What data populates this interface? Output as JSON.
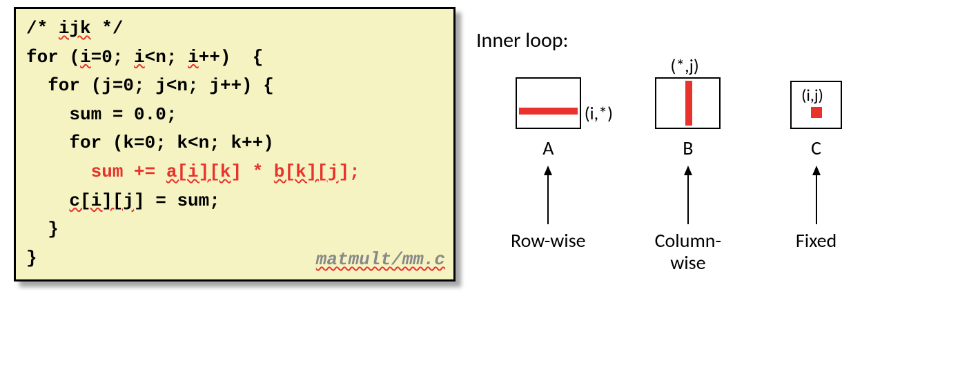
{
  "code": {
    "comment": "/* ijk */",
    "line1": "for (i=0; i<n; i++)  {",
    "line2": "  for (j=0; j<n; j++) {",
    "line3": "    sum = 0.0;",
    "line4": "    for (k=0; k<n; k++)",
    "line5_inner": "      sum += a[i][k] * b[k][j];",
    "line6": "    c[i][j] = sum;",
    "line7": "  }",
    "line8": "}",
    "file": "matmult/mm.c"
  },
  "diagram": {
    "title": "Inner loop:",
    "matrixA": {
      "name": "A",
      "coord": "(i,*)",
      "access": "Row-wise"
    },
    "matrixB": {
      "name": "B",
      "coord": "(*,j)",
      "access": "Column-wise"
    },
    "matrixC": {
      "name": "C",
      "coord": "(i,j)",
      "access": "Fixed"
    }
  }
}
